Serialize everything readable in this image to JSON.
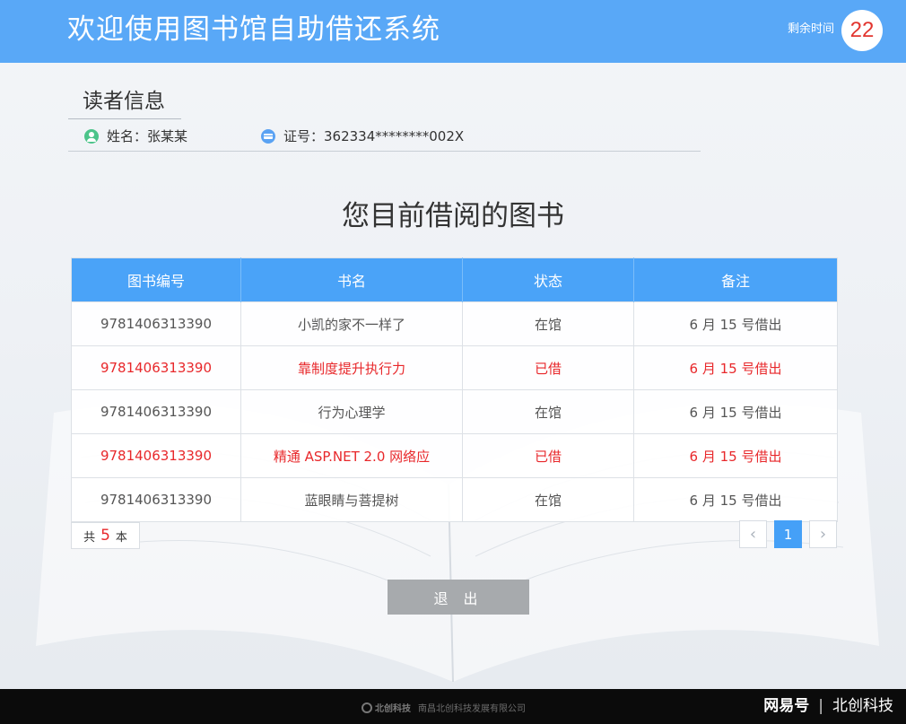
{
  "header": {
    "title": "欢迎使用图书馆自助借还系统",
    "timer_label": "剩余时间",
    "timer_value": "22"
  },
  "reader": {
    "section_title": "读者信息",
    "name": "姓名：张某某",
    "card_no": "证号：362334********002X"
  },
  "books": {
    "title": "您目前借阅的图书",
    "columns": [
      "图书编号",
      "书名",
      "状态",
      "备注"
    ],
    "rows": [
      {
        "id": "9781406313390",
        "name": "小凯的家不一样了",
        "status": "在馆",
        "note": "6 月 15 号借出",
        "borrowed": false
      },
      {
        "id": "9781406313390",
        "name": "靠制度提升执行力",
        "status": "已借",
        "note": "6 月 15 号借出",
        "borrowed": true
      },
      {
        "id": "9781406313390",
        "name": "行为心理学",
        "status": "在馆",
        "note": "6 月 15 号借出",
        "borrowed": false
      },
      {
        "id": "9781406313390",
        "name": "精通 ASP.NET 2.0 网络应",
        "status": "已借",
        "note": "6 月 15 号借出",
        "borrowed": true
      },
      {
        "id": "9781406313390",
        "name": "蓝眼睛与菩提树",
        "status": "在馆",
        "note": "6 月 15 号借出",
        "borrowed": false
      }
    ]
  },
  "summary": {
    "prefix": "共",
    "count": "5",
    "suffix": "本"
  },
  "pagination": {
    "prev_icon": "chevron-left-icon",
    "prev_glyph": "‹",
    "current_page": "1",
    "next_icon": "chevron-right-icon",
    "next_glyph": "›"
  },
  "actions": {
    "exit_label": "退 出"
  },
  "footer": {
    "logo_text": "北创科技",
    "company": "南昌北创科技发展有限公司"
  },
  "watermark": {
    "brand": "网易号",
    "separator": "|",
    "author": "北创科技"
  },
  "colors": {
    "header_bg": "#59a8f7",
    "table_header_bg": "#4aa3f8",
    "borrowed_text": "#e8282b",
    "exit_button_bg": "#a7aaad",
    "footer_bg": "#0b0b0b"
  }
}
